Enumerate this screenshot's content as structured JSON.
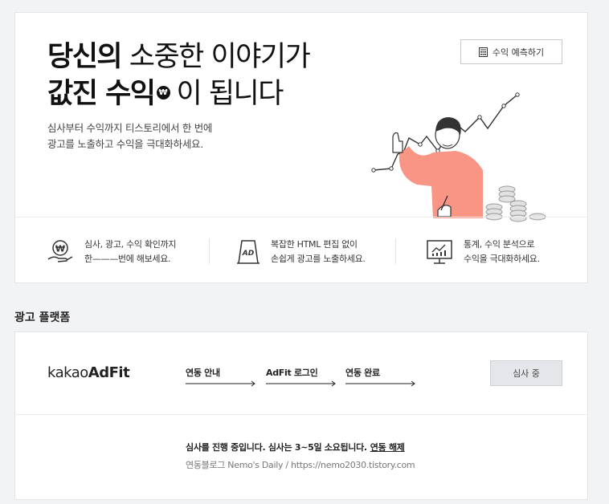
{
  "hero": {
    "title_line1_bold": "당신의",
    "title_line1_rest": "소중한 이야기가",
    "title_line2_bold": "값진 수익",
    "coin_symbol": "₩",
    "title_line2_rest": "이 됩니다",
    "desc_line1": "심사부터 수익까지 티스토리에서 한 번에",
    "desc_line2": "광고를 노출하고 수익을 극대화하세요.",
    "forecast_button": "수익 예측하기"
  },
  "features": [
    {
      "icon": "hand-coin-icon",
      "line1": "심사, 광고, 수익 확인까지",
      "line2": "한———번에 해보세요."
    },
    {
      "icon": "ad-board-icon",
      "line1": "복잡한 HTML 편집 없이",
      "line2": "손쉽게 광고를 노출하세요."
    },
    {
      "icon": "monitor-chart-icon",
      "line1": "통계, 수익 분석으로",
      "line2": "수익을 극대화하세요."
    }
  ],
  "ad_board_text": "AD",
  "section_title": "광고 플랫폼",
  "platform": {
    "logo_light": "kakao",
    "logo_bold": "AdFit",
    "steps": [
      "연동 안내",
      "AdFit 로그인",
      "연동 완료"
    ],
    "review_button": "심사 중",
    "status_text": "심사를 진행 중입니다. 심사는 3~5일 소요됩니다.",
    "unlink_text": "연동 해제",
    "blog_info": "연동블로그 Nemo's Daily / https://nemo2030.tistory.com"
  },
  "colors": {
    "accent_sweater": "#f99585",
    "coin": "#d9d9d9"
  }
}
